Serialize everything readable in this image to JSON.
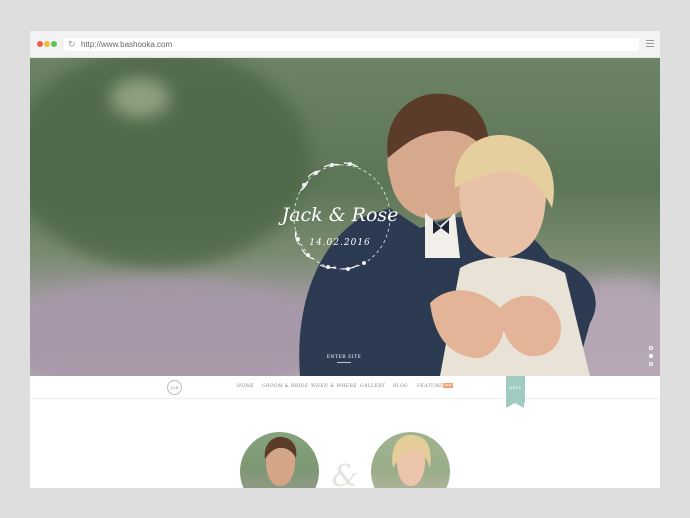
{
  "browser": {
    "url": "http://www.bashooka.com",
    "refresh_icon": "refresh-icon",
    "menu_icon": "hamburger-menu-icon"
  },
  "hero": {
    "couple_names": "Jack & Rose",
    "wedding_date": "14.02.2016",
    "enter_label": "ENTER SITE",
    "slides_total": 3,
    "active_slide": 2
  },
  "nav": {
    "logo_monogram": "J&R",
    "items": [
      "HOME",
      "GROOM & BRIDE",
      "WHEN & WHERE",
      "GALLERY",
      "BLOG",
      "FEATURES"
    ],
    "features_badge": "NEW",
    "rsvp_label": "RSVP"
  },
  "couple_section": {
    "ampersand": "&"
  },
  "colors": {
    "rsvp": "#9fcbc0",
    "badge": "#f0a072",
    "accent_text": "#888888"
  }
}
